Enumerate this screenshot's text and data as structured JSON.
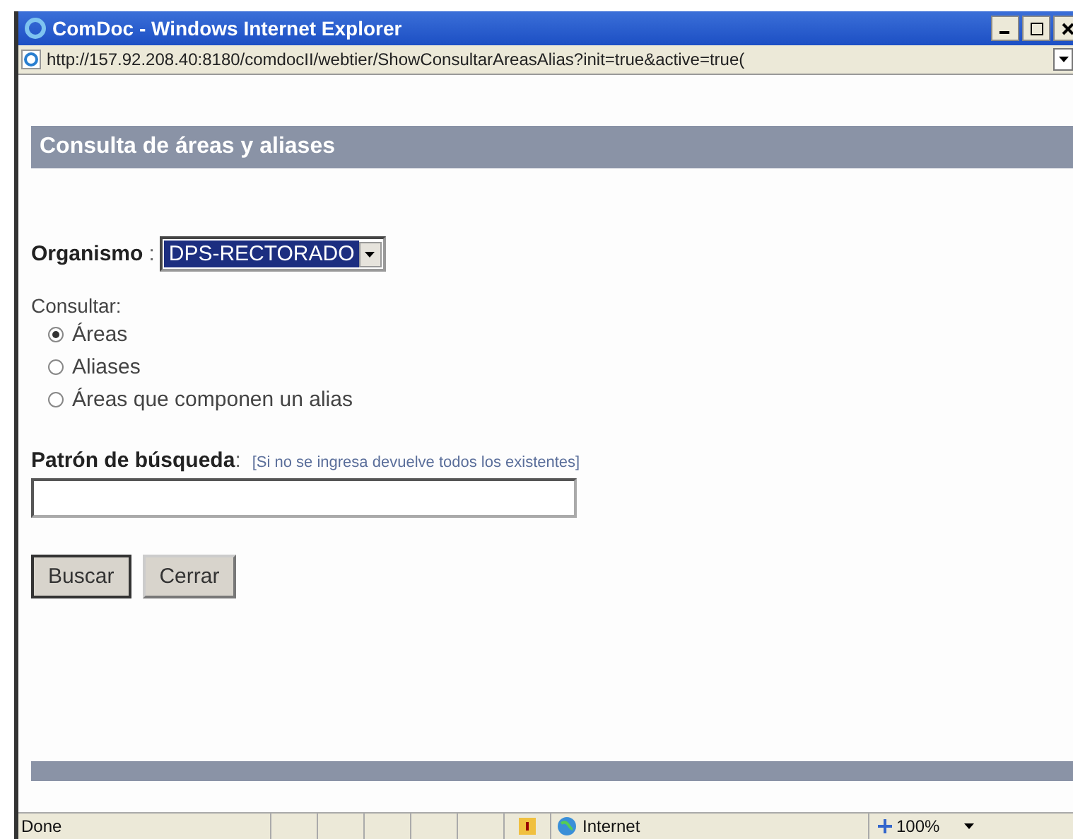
{
  "window": {
    "title": "ComDoc - Windows Internet Explorer"
  },
  "address_bar": {
    "url": "http://157.92.208.40:8180/comdocII/webtier/ShowConsultarAreasAlias?init=true&active=true("
  },
  "page": {
    "header": "Consulta de áreas y aliases",
    "organismo": {
      "label": "Organismo",
      "separator": ":",
      "value": "DPS-RECTORADO"
    },
    "consultar": {
      "label": "Consultar:",
      "options": [
        {
          "label": "Áreas",
          "selected": true
        },
        {
          "label": "Aliases",
          "selected": false
        },
        {
          "label": "Áreas que componen un alias",
          "selected": false
        }
      ]
    },
    "search": {
      "label": "Patrón de búsqueda",
      "separator": ":",
      "hint": "[Si no se ingresa devuelve todos los existentes]"
    },
    "buttons": [
      {
        "label": "Buscar",
        "default": true
      },
      {
        "label": "Cerrar",
        "default": false
      }
    ]
  },
  "status_bar": {
    "text": "Done",
    "zone": "Internet",
    "zoom": "100%"
  }
}
